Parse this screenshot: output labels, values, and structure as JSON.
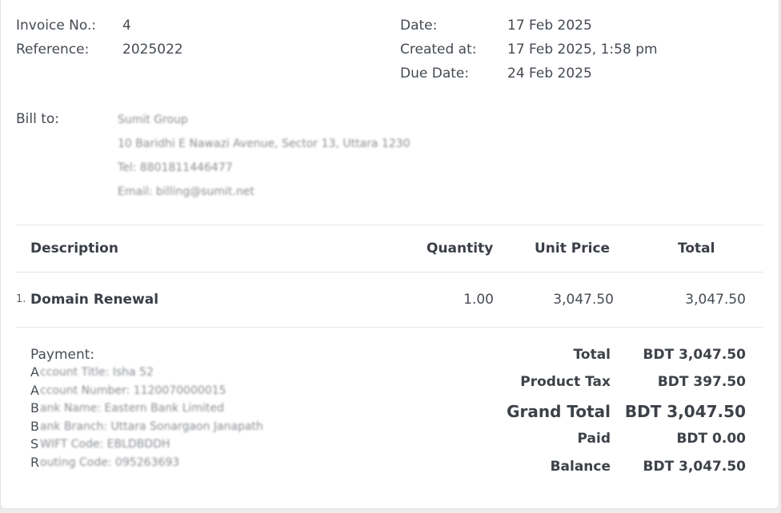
{
  "invoice": {
    "number_label": "Invoice No.:",
    "number": "4",
    "reference_label": "Reference:",
    "reference": "2025022",
    "date_label": "Date:",
    "date": "17 Feb 2025",
    "created_label": "Created at:",
    "created": "17 Feb 2025, 1:58 pm",
    "due_label": "Due Date:",
    "due": "24 Feb 2025"
  },
  "bill_to": {
    "label": "Bill to:",
    "lines": [
      "Sumit Group",
      "10 Baridhi E Nawazi Avenue, Sector 13, Uttara 1230",
      "Tel: 8801811446477",
      "Email: billing@sumit.net"
    ]
  },
  "table": {
    "headers": {
      "description": "Description",
      "quantity": "Quantity",
      "unit_price": "Unit Price",
      "total": "Total"
    },
    "rows": [
      {
        "num": "1.",
        "description": "Domain Renewal",
        "quantity": "1.00",
        "unit_price": "3,047.50",
        "total": "3,047.50"
      }
    ]
  },
  "payment": {
    "label": "Payment:",
    "lines": [
      {
        "first": "A",
        "rest": "ccount Title: Isha 52"
      },
      {
        "first": "A",
        "rest": "ccount Number: 1120070000015"
      },
      {
        "first": "B",
        "rest": "ank Name: Eastern Bank Limited"
      },
      {
        "first": "B",
        "rest": "ank Branch: Uttara Sonargaon Janapath"
      },
      {
        "first": "S",
        "rest": "WIFT Code: EBLDBDDH"
      },
      {
        "first": "R",
        "rest": "outing Code: 095263693"
      }
    ]
  },
  "totals": {
    "total_label": "Total",
    "total": "BDT 3,047.50",
    "tax_label": "Product Tax",
    "tax": "BDT 397.50",
    "grand_label": "Grand Total",
    "grand": "BDT 3,047.50",
    "paid_label": "Paid",
    "paid": "BDT 0.00",
    "balance_label": "Balance",
    "balance": "BDT 3,047.50"
  }
}
